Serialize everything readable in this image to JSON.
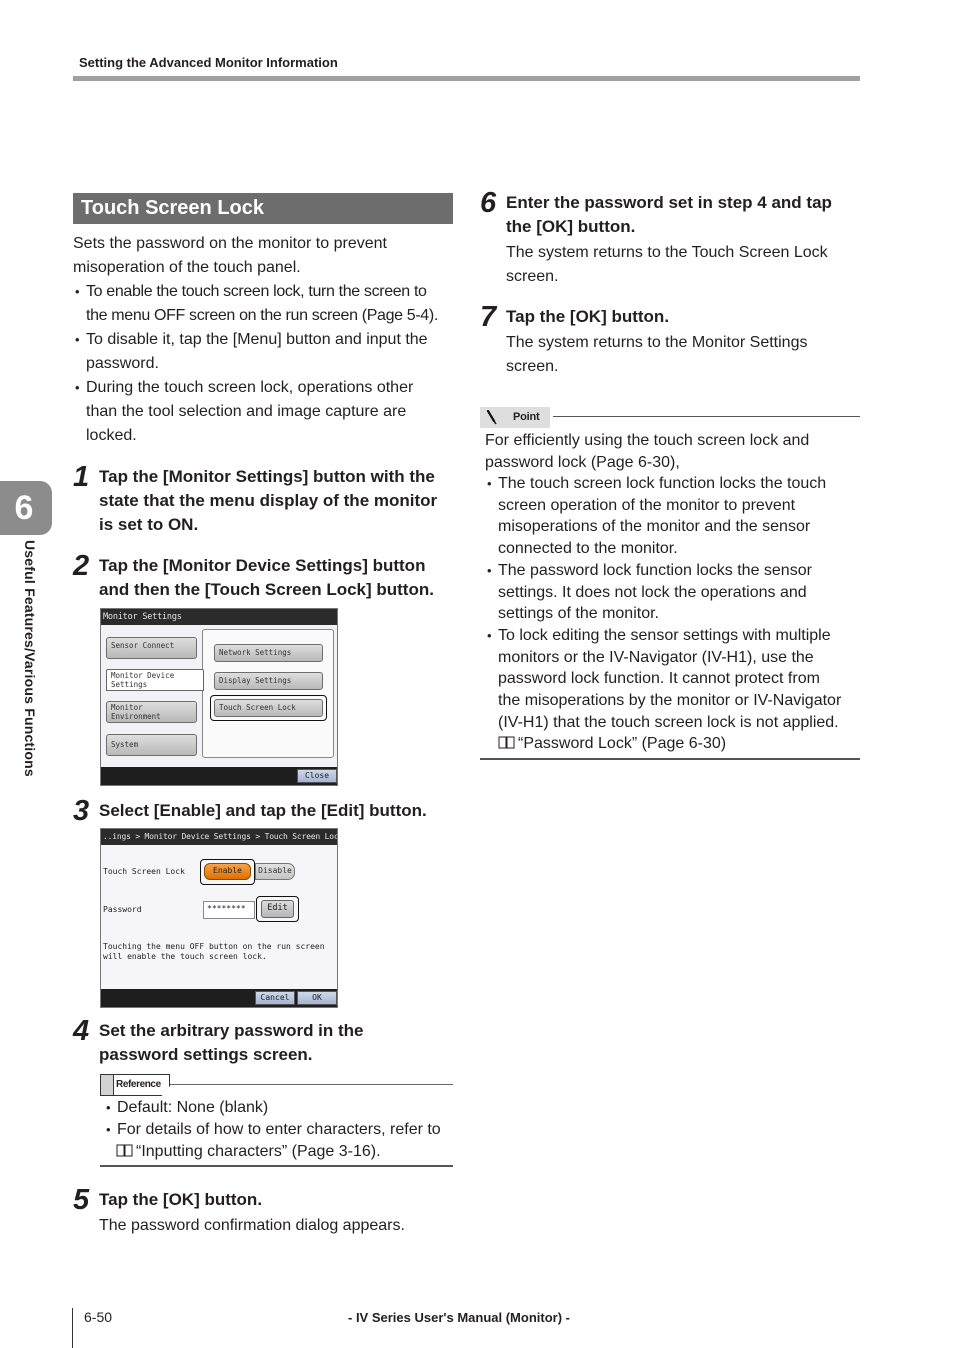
{
  "header": {
    "section_title": "Setting the Advanced Monitor Information"
  },
  "side_tab": {
    "chapter_number": "6",
    "chapter_label": "Useful Features/Various Functions"
  },
  "left_column": {
    "section_heading": "Touch Screen Lock",
    "intro": "Sets the password on the monitor to prevent misoperation of the touch panel.",
    "intro_lines": [
      "Sets the password on the monitor to prevent",
      "misoperation of the touch panel."
    ],
    "bullets": [
      [
        "To enable the touch screen lock, turn the screen to",
        "the menu OFF screen on the run screen (Page 5-4)."
      ],
      [
        "To disable it, tap the [Menu] button and input the",
        "password."
      ],
      [
        "During the touch screen lock, operations other",
        "than the tool selection and image capture are",
        "locked."
      ]
    ],
    "steps": [
      {
        "number": "1",
        "lines": [
          "Tap the [Monitor Settings] button with the",
          "state that the menu display of the monitor",
          "is set to ON."
        ]
      },
      {
        "number": "2",
        "lines": [
          "Tap the [Monitor Device Settings] button",
          "and then the [Touch Screen Lock] button."
        ]
      },
      {
        "number": "3",
        "lines": [
          "Select [Enable] and tap the [Edit] button."
        ]
      },
      {
        "number": "4",
        "lines": [
          "Set the arbitrary password in the",
          "password settings screen."
        ]
      },
      {
        "number": "5",
        "lines": [
          "Tap the [OK] button."
        ],
        "description": "The password confirmation dialog appears."
      }
    ],
    "reference": {
      "label": "Reference",
      "bullets": [
        [
          "Default: None (blank)"
        ],
        [
          "For details of how to enter characters, refer to",
          "“Inputting characters” (Page 3-16)."
        ]
      ]
    }
  },
  "screen_monitor_settings": {
    "title": "Monitor Settings",
    "left_buttons": [
      {
        "label": "Sensor Connect",
        "selected": false
      },
      {
        "label": "Monitor Device Settings",
        "line1": "Monitor Device",
        "line2": "Settings",
        "selected": true
      },
      {
        "label": "Monitor Environment",
        "line1": "Monitor",
        "line2": "Environment",
        "selected": false
      },
      {
        "label": "System",
        "selected": false
      }
    ],
    "right_buttons": [
      {
        "label": "Network Settings"
      },
      {
        "label": "Display Settings"
      },
      {
        "label": "Touch Screen Lock",
        "highlighted": true
      }
    ],
    "close_label": "Close"
  },
  "screen_touch_lock": {
    "breadcrumb": "..ings > Monitor Device Settings > Touch Screen Lock",
    "lock_label": "Touch Screen Lock",
    "enable_label": "Enable",
    "disable_label": "Disable",
    "lock_state": "Enable",
    "password_label": "Password",
    "password_value": "********",
    "edit_label": "Edit",
    "message_lines": [
      "Touching the menu OFF button on the run screen",
      "will enable the touch screen lock."
    ],
    "cancel_label": "Cancel",
    "ok_label": "OK",
    "colors": {
      "enable_active": "#f08a1c"
    }
  },
  "right_column": {
    "steps": [
      {
        "number": "6",
        "lines": [
          "Enter the password set in step 4 and tap",
          "the [OK] button."
        ],
        "description_lines": [
          "The system returns to the Touch Screen Lock",
          "screen."
        ]
      },
      {
        "number": "7",
        "lines": [
          "Tap the [OK] button."
        ],
        "description_lines": [
          "The system returns to the Monitor Settings",
          "screen."
        ]
      }
    ],
    "point": {
      "label": "Point",
      "intro_lines": [
        "For efficiently using the touch screen lock and",
        "password lock (Page 6-30),"
      ],
      "bullets": [
        [
          "The touch screen lock function locks the touch",
          "screen operation of the monitor to prevent",
          "misoperations of the monitor and the sensor",
          "connected to the monitor."
        ],
        [
          "The password lock function locks the sensor",
          "settings. It does not lock the operations and",
          "settings of the monitor."
        ],
        [
          "To lock editing the sensor settings with multiple",
          "monitors or the IV-Navigator (IV-H1), use the",
          "password lock function. It cannot protect from",
          "the misoperations by the monitor or IV-Navigator",
          "(IV-H1) that the touch screen lock is not applied.",
          "“Password Lock” (Page 6-30)"
        ]
      ]
    }
  },
  "footer": {
    "page_number": "6-50",
    "manual_title": "- IV Series User's Manual (Monitor) -"
  }
}
